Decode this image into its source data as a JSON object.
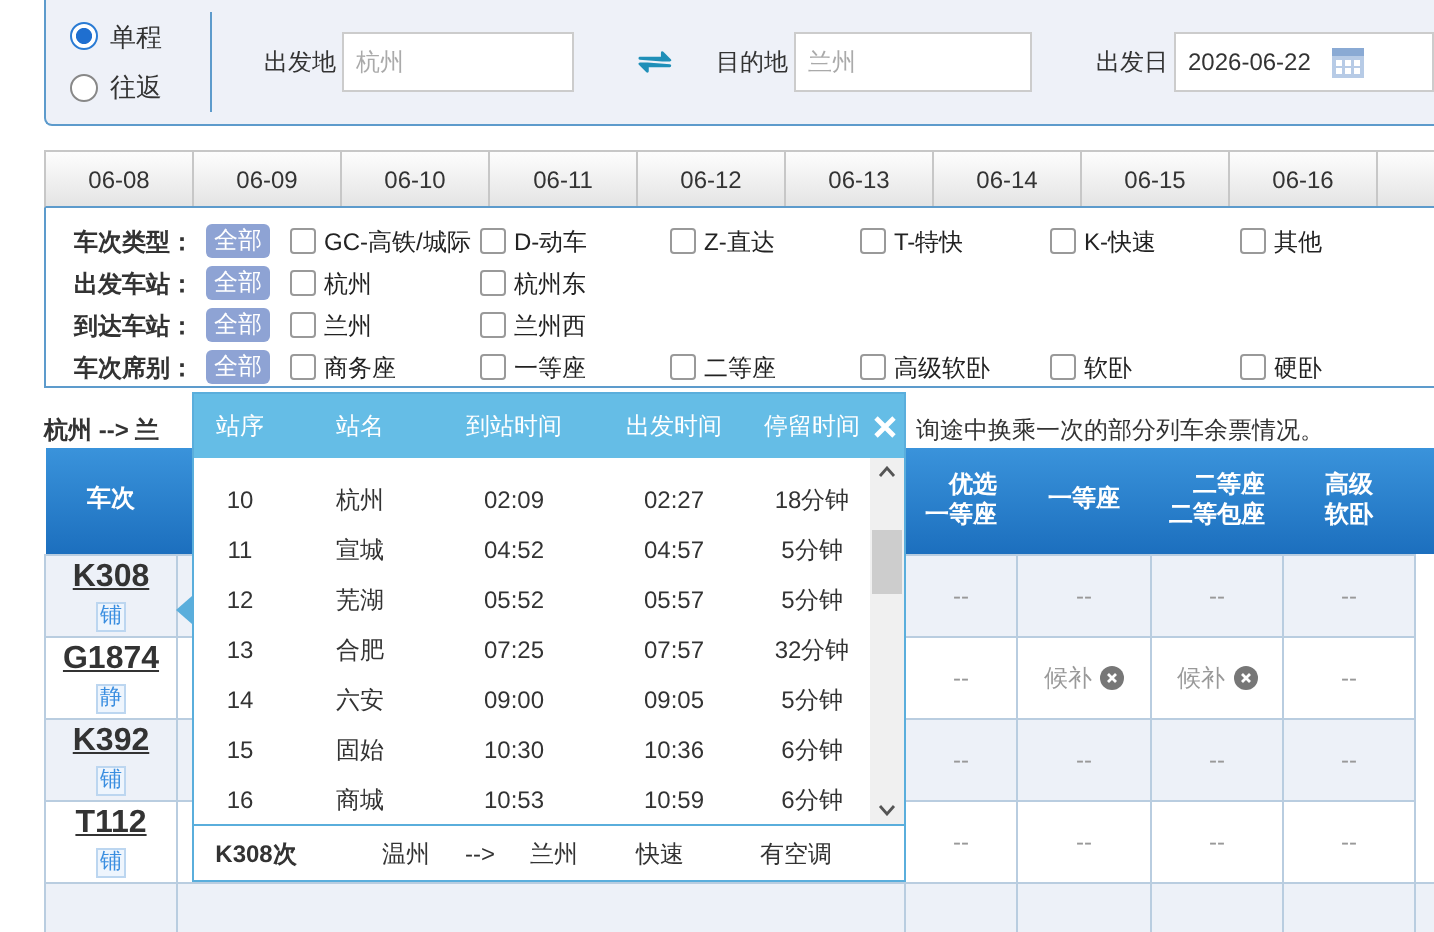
{
  "trip_type": [
    {
      "label": "单程",
      "selected": true
    },
    {
      "label": "往返",
      "selected": false
    }
  ],
  "from_field": {
    "label": "出发地",
    "placeholder": "杭州"
  },
  "to_field": {
    "label": "目的地",
    "placeholder": "兰州"
  },
  "date_field": {
    "label": "出发日",
    "value": "2026-06-22"
  },
  "date_tabs": [
    "06-08",
    "06-09",
    "06-10",
    "06-11",
    "06-12",
    "06-13",
    "06-14",
    "06-15",
    "06-16"
  ],
  "filters": [
    {
      "label": "车次类型：",
      "all": "全部",
      "options": [
        {
          "label": "GC-高铁/城际",
          "checked": false
        },
        {
          "label": "D-动车",
          "checked": false
        },
        {
          "label": "Z-直达",
          "checked": false
        },
        {
          "label": "T-特快",
          "checked": false
        },
        {
          "label": "K-快速",
          "checked": false
        },
        {
          "label": "其他",
          "checked": false
        }
      ]
    },
    {
      "label": "出发车站：",
      "all": "全部",
      "options": [
        {
          "label": "杭州",
          "checked": false
        },
        {
          "label": "杭州东",
          "checked": false
        }
      ]
    },
    {
      "label": "到达车站：",
      "all": "全部",
      "options": [
        {
          "label": "兰州",
          "checked": false
        },
        {
          "label": "兰州西",
          "checked": false
        }
      ]
    },
    {
      "label": "车次席别：",
      "all": "全部",
      "options": [
        {
          "label": "商务座",
          "checked": false
        },
        {
          "label": "一等座",
          "checked": false
        },
        {
          "label": "二等座",
          "checked": false
        },
        {
          "label": "高级软卧",
          "checked": false
        },
        {
          "label": "软卧",
          "checked": false
        },
        {
          "label": "硬卧",
          "checked": false
        }
      ]
    }
  ],
  "route": {
    "left": "杭州 --> 兰",
    "right": "询途中换乘一次的部分列车余票情况。"
  },
  "table": {
    "columns": [
      "车次",
      "优选一等座",
      "一等座",
      "二等座二等包座",
      "高级软卧"
    ],
    "rows": [
      {
        "cells": [
          {
            "kind": "train",
            "text": "K308",
            "tag": "铺"
          },
          {
            "kind": "none",
            "text": "--"
          },
          {
            "kind": "none",
            "text": "--"
          },
          {
            "kind": "none",
            "text": "--"
          },
          {
            "kind": "none",
            "text": "--"
          }
        ]
      },
      {
        "cells": [
          {
            "kind": "train",
            "text": "G1874",
            "tag": "静"
          },
          {
            "kind": "none",
            "text": "--"
          },
          {
            "kind": "waitlist",
            "text": "候补"
          },
          {
            "kind": "waitlist",
            "text": "候补"
          },
          {
            "kind": "none",
            "text": "--"
          }
        ]
      },
      {
        "cells": [
          {
            "kind": "train",
            "text": "K392",
            "tag": "铺"
          },
          {
            "kind": "none",
            "text": "--"
          },
          {
            "kind": "none",
            "text": "--"
          },
          {
            "kind": "none",
            "text": "--"
          },
          {
            "kind": "none",
            "text": "--"
          }
        ]
      },
      {
        "cells": [
          {
            "kind": "train",
            "text": "T112",
            "tag": "铺"
          },
          {
            "kind": "none",
            "text": "--"
          },
          {
            "kind": "none",
            "text": "--"
          },
          {
            "kind": "none",
            "text": "--"
          },
          {
            "kind": "none",
            "text": "--"
          }
        ]
      }
    ]
  },
  "popup": {
    "columns": [
      "站序",
      "站名",
      "到站时间",
      "出发时间",
      "停留时间"
    ],
    "rows": [
      [
        "10",
        "杭州",
        "02:09",
        "02:27",
        "18分钟"
      ],
      [
        "11",
        "宣城",
        "04:52",
        "04:57",
        "5分钟"
      ],
      [
        "12",
        "芜湖",
        "05:52",
        "05:57",
        "5分钟"
      ],
      [
        "13",
        "合肥",
        "07:25",
        "07:57",
        "32分钟"
      ],
      [
        "14",
        "六安",
        "09:00",
        "09:05",
        "5分钟"
      ],
      [
        "15",
        "固始",
        "10:30",
        "10:36",
        "6分钟"
      ],
      [
        "16",
        "商城",
        "10:53",
        "10:59",
        "6分钟"
      ]
    ],
    "footer": {
      "train": "K308次",
      "from": "温州",
      "arrow": "-->",
      "to": "兰州",
      "type": "快速",
      "aircon": "有空调"
    }
  }
}
